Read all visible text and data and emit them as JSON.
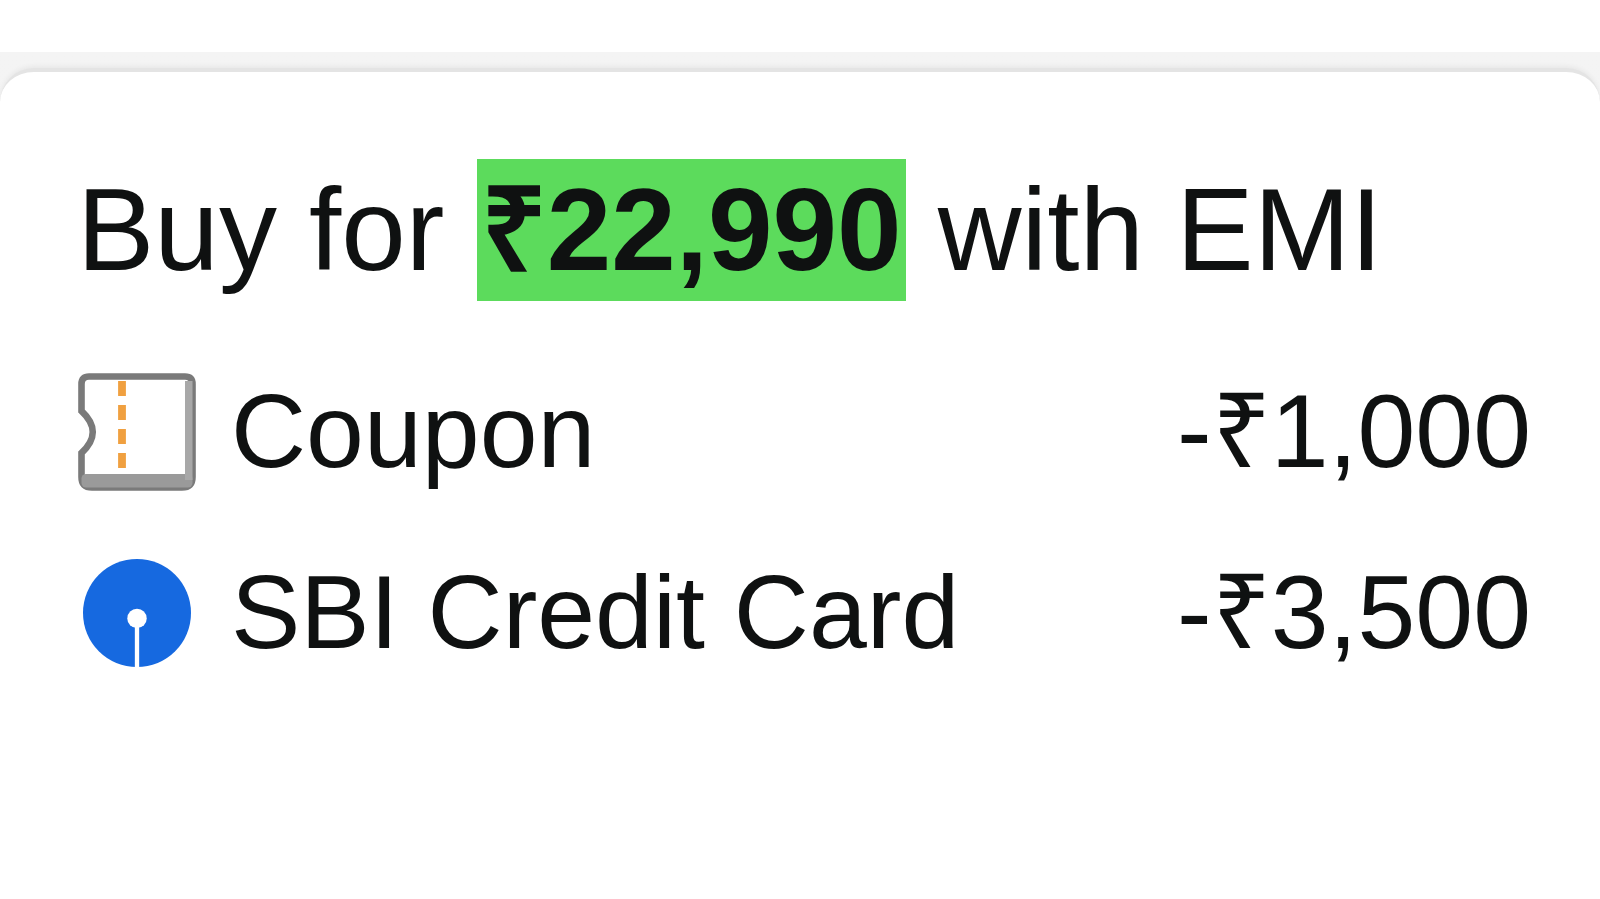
{
  "emi_offer": {
    "heading": "Buy for **₹22,990** with EMI",
    "discounts": [
      {
        "kind": "coupon",
        "label": "Coupon",
        "amount": "-₹1,000"
      },
      {
        "kind": "bank_card",
        "label": "SBI Credit Card",
        "amount": "-₹3,500"
      }
    ]
  }
}
